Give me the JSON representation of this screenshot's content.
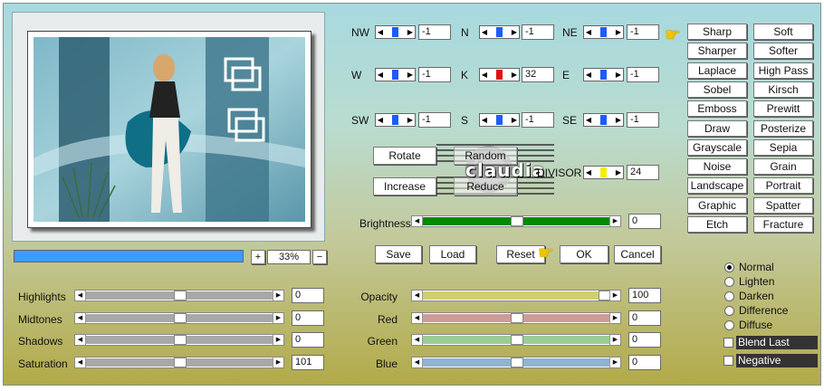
{
  "colors": {
    "accent_blue": "#1e5bff",
    "kernel_red": "#e01010",
    "divisor_yellow": "#f5f000",
    "progress_blue": "#3b9cff",
    "brightness_green": "#008a00"
  },
  "preview": {
    "progress_percent": 100,
    "zoom": {
      "plus": "+",
      "value": "33%",
      "minus": "−"
    },
    "watermark": "claudia"
  },
  "kernel": {
    "row1": [
      {
        "label": "NW",
        "value": "-1"
      },
      {
        "label": "N",
        "value": "-1"
      },
      {
        "label": "NE",
        "value": "-1"
      }
    ],
    "row2": [
      {
        "label": "W",
        "value": "-1"
      },
      {
        "label": "K",
        "value": "32"
      },
      {
        "label": "E",
        "value": "-1"
      }
    ],
    "row3": [
      {
        "label": "SW",
        "value": "-1"
      },
      {
        "label": "S",
        "value": "-1"
      },
      {
        "label": "SE",
        "value": "-1"
      }
    ]
  },
  "actions": {
    "rotate": "Rotate",
    "random": "Random",
    "increase": "Increase",
    "reduce": "Reduce",
    "divisor_label": "DIVISOR",
    "divisor_value": "24",
    "brightness_label": "Brightness",
    "brightness_value": "0",
    "save": "Save",
    "load": "Load",
    "reset": "Reset",
    "ok": "OK",
    "cancel": "Cancel"
  },
  "filters": [
    [
      "Sharp",
      "Soft"
    ],
    [
      "Sharper",
      "Softer"
    ],
    [
      "Laplace",
      "High Pass"
    ],
    [
      "Sobel",
      "Kirsch"
    ],
    [
      "Emboss",
      "Prewitt"
    ],
    [
      "Draw",
      "Posterize"
    ],
    [
      "Grayscale",
      "Sepia"
    ],
    [
      "Noise",
      "Grain"
    ],
    [
      "Landscape",
      "Portrait"
    ],
    [
      "Graphic",
      "Spatter"
    ],
    [
      "Etch",
      "Fracture"
    ]
  ],
  "tone": [
    {
      "label": "Highlights",
      "value": "0"
    },
    {
      "label": "Midtones",
      "value": "0"
    },
    {
      "label": "Shadows",
      "value": "0"
    },
    {
      "label": "Saturation",
      "value": "101"
    }
  ],
  "blend": [
    {
      "label": "Opacity",
      "value": "100"
    },
    {
      "label": "Red",
      "value": "0"
    },
    {
      "label": "Green",
      "value": "0"
    },
    {
      "label": "Blue",
      "value": "0"
    }
  ],
  "modes": [
    {
      "label": "Normal",
      "selected": true
    },
    {
      "label": "Lighten",
      "selected": false
    },
    {
      "label": "Darken",
      "selected": false
    },
    {
      "label": "Difference",
      "selected": false
    },
    {
      "label": "Diffuse",
      "selected": false
    }
  ],
  "options": [
    {
      "label": "Blend Last",
      "checked": false
    },
    {
      "label": "Negative",
      "checked": false
    }
  ]
}
